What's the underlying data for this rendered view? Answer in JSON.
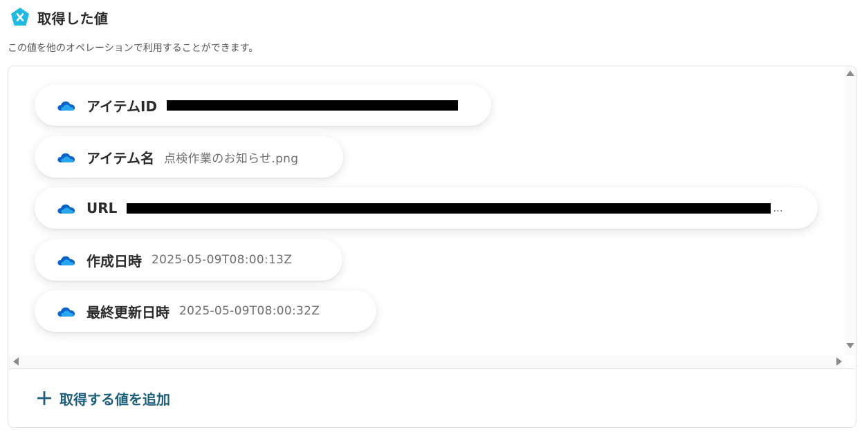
{
  "header": {
    "title": "取得した値",
    "icon": "yoom-x-icon",
    "icon_color": "#22b8e0"
  },
  "subtitle": "この値を他のオペレーションで利用することができます。",
  "values": [
    {
      "label": "アイテムID",
      "value": "",
      "redacted": true,
      "icon": "onedrive-cloud-icon"
    },
    {
      "label": "アイテム名",
      "value": "点検作業のお知らせ.png",
      "redacted": false,
      "icon": "onedrive-cloud-icon"
    },
    {
      "label": "URL",
      "value": "",
      "redacted": true,
      "truncated": "...",
      "icon": "onedrive-cloud-icon"
    },
    {
      "label": "作成日時",
      "value": "2025-05-09T08:00:13Z",
      "redacted": false,
      "icon": "onedrive-cloud-icon"
    },
    {
      "label": "最終更新日時",
      "value": "2025-05-09T08:00:32Z",
      "redacted": false,
      "icon": "onedrive-cloud-icon"
    }
  ],
  "add_button": {
    "label": "取得する値を追加",
    "icon": "plus-icon",
    "color": "#1d5f7a"
  },
  "colors": {
    "onedrive_dark": "#0a64c8",
    "onedrive_light": "#2aa6f0"
  }
}
